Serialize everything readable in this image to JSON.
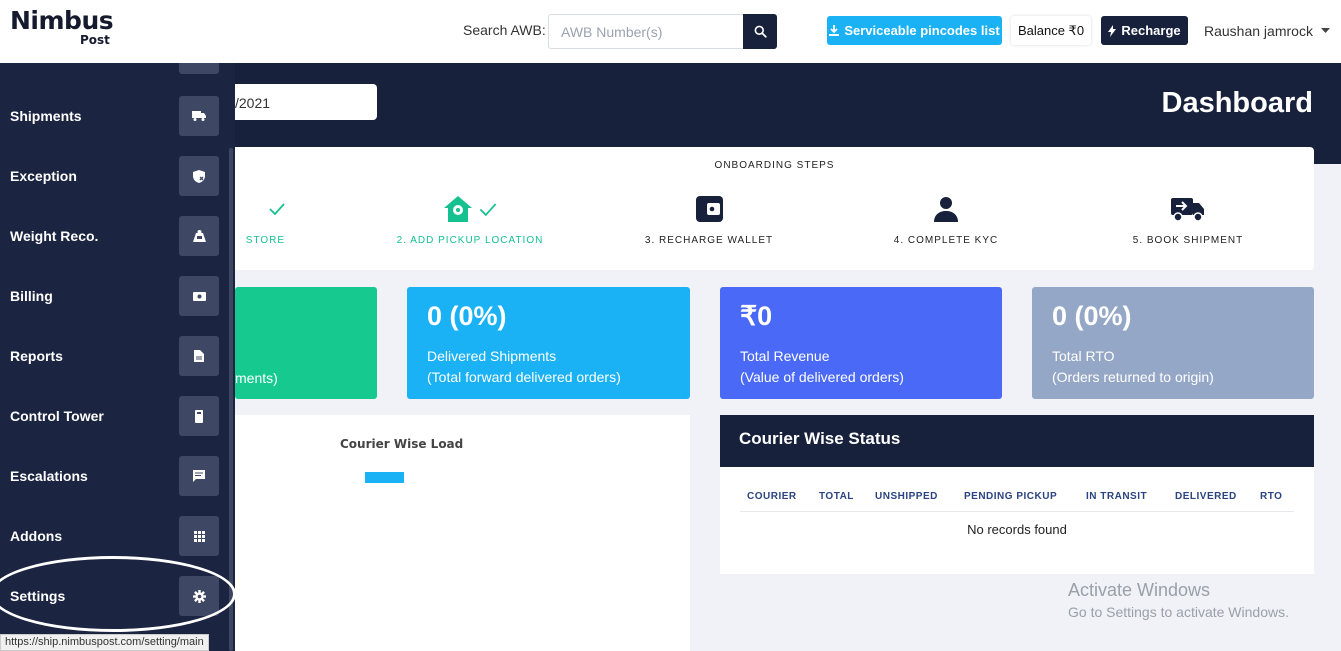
{
  "header": {
    "logo_main": "Nimbus",
    "logo_sub": "Post",
    "search_label": "Search AWB:",
    "search_placeholder": "AWB Number(s)",
    "pincodes_label": "Serviceable pincodes list",
    "balance_label": "Balance ₹0",
    "recharge_label": "Recharge",
    "user_name": "Raushan jamrock"
  },
  "banner": {
    "date_value": "/2021",
    "title": "Dashboard"
  },
  "onboarding": {
    "title": "ONBOARDING STEPS",
    "steps": [
      {
        "label": "STORE",
        "done": true
      },
      {
        "label": "2. ADD PICKUP LOCATION",
        "done": true
      },
      {
        "label": "3. RECHARGE WALLET",
        "done": false
      },
      {
        "label": "4. COMPLETE KYC",
        "done": false
      },
      {
        "label": "5. BOOK SHIPMENT",
        "done": false
      }
    ]
  },
  "stats": [
    {
      "value": "",
      "label1": "",
      "label2": "ments)",
      "color": "#16c98f"
    },
    {
      "value": "0 (0%)",
      "label1": "Delivered Shipments",
      "label2": "(Total forward delivered orders)",
      "color": "#1ab2f5"
    },
    {
      "value": "₹0",
      "label1": "Total Revenue",
      "label2": "(Value of delivered orders)",
      "color": "#4a69f7"
    },
    {
      "value": "0 (0%)",
      "label1": "Total RTO",
      "label2": "(Orders returned to origin)",
      "color": "#95a7c6"
    }
  ],
  "courier_load": {
    "title": "Courier Wise Load"
  },
  "courier_status": {
    "title": "Courier Wise Status",
    "columns": [
      "COURIER",
      "TOTAL",
      "UNSHIPPED",
      "PENDING PICKUP",
      "IN TRANSIT",
      "DELIVERED",
      "RTO"
    ],
    "empty_text": "No records found"
  },
  "sidebar": {
    "items": [
      {
        "label": "Shipments",
        "icon": "truck-icon"
      },
      {
        "label": "Exception",
        "icon": "shield-x-icon"
      },
      {
        "label": "Weight Reco.",
        "icon": "scale-icon"
      },
      {
        "label": "Billing",
        "icon": "money-icon"
      },
      {
        "label": "Reports",
        "icon": "document-icon"
      },
      {
        "label": "Control Tower",
        "icon": "device-icon"
      },
      {
        "label": "Escalations",
        "icon": "chat-icon"
      },
      {
        "label": "Addons",
        "icon": "grid-icon"
      },
      {
        "label": "Settings",
        "icon": "gear-icon"
      }
    ]
  },
  "statusbar": {
    "url": "https://ship.nimbuspost.com/setting/main"
  },
  "watermark": {
    "title": "Activate Windows",
    "subtitle": "Go to Settings to activate Windows."
  },
  "colors": {
    "navy": "#17213c",
    "sidebar": "#1b2440",
    "accent_blue": "#1ab2f5",
    "success_green": "#16c190"
  }
}
